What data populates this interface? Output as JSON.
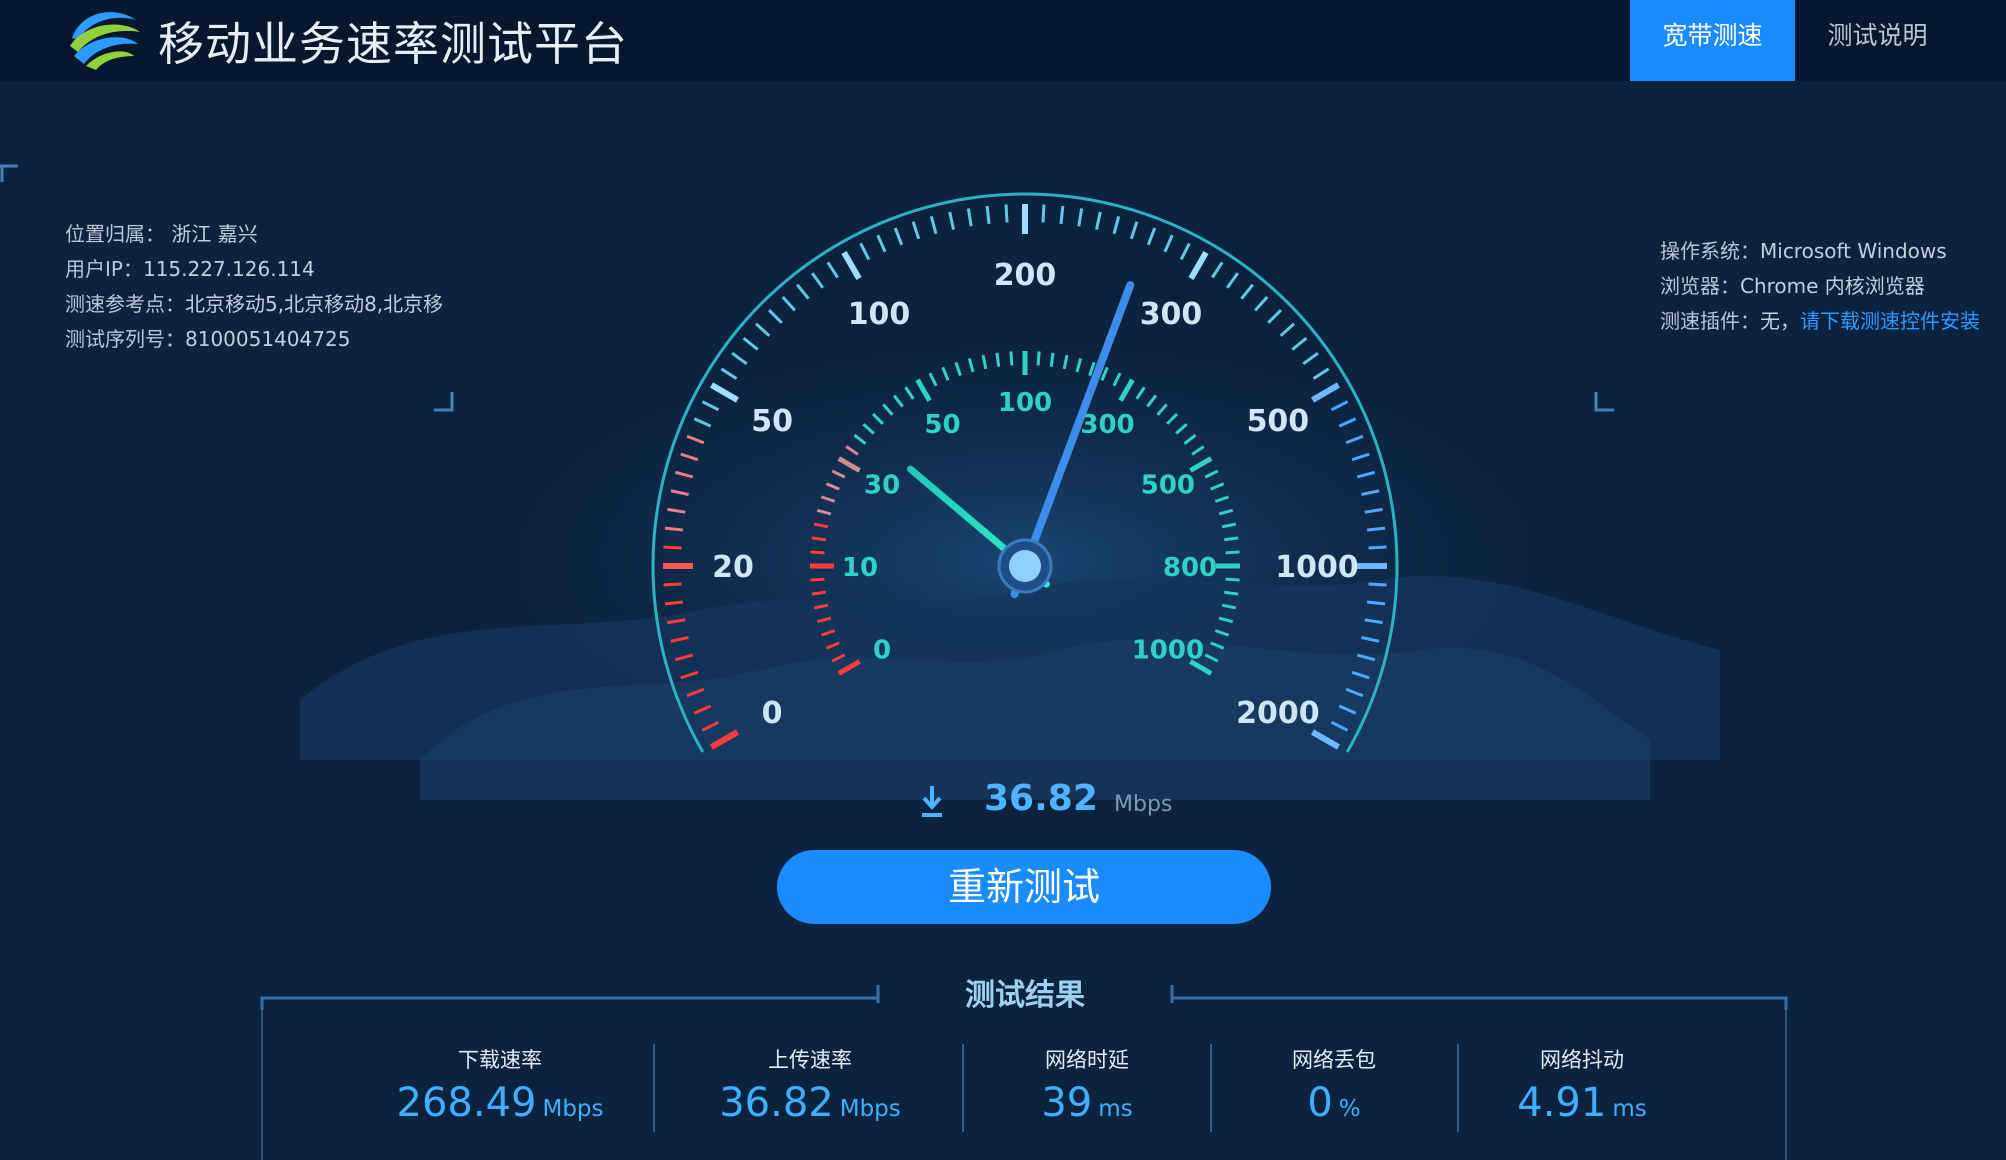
{
  "header": {
    "title": "移动业务速率测试平台",
    "tabs": [
      {
        "label": "宽带测速",
        "active": true
      },
      {
        "label": "测试说明",
        "active": false
      }
    ]
  },
  "info_left": {
    "location_label": "位置归属：",
    "location_value": "浙江 嘉兴",
    "ip_label": "用户IP：",
    "ip_value": "115.227.126.114",
    "ref_label": "测速参考点：",
    "ref_value": "北京移动5,北京移动8,北京移",
    "serial_label": "测试序列号：",
    "serial_value": "8100051404725"
  },
  "info_right": {
    "os_label": "操作系统：",
    "os_value": "Microsoft Windows",
    "browser_label": "浏览器：",
    "browser_value": "Chrome 内核浏览器",
    "plugin_label": "测速插件：",
    "plugin_value": "无，",
    "plugin_link": "请下载测速控件安装"
  },
  "gauge": {
    "outer_labels": [
      "0",
      "20",
      "50",
      "100",
      "200",
      "300",
      "500",
      "1000",
      "2000"
    ],
    "inner_labels": [
      "0",
      "10",
      "30",
      "50",
      "100",
      "300",
      "500",
      "800",
      "1000"
    ],
    "outer_needle_value": 268.49,
    "inner_needle_value": 36.82
  },
  "speed": {
    "value": "36.82",
    "unit": "Mbps",
    "icon": "download-arrow-icon"
  },
  "retest_label": "重新测试",
  "results": {
    "title": "测试结果",
    "items": [
      {
        "label": "下载速率",
        "value": "268.49",
        "unit": "Mbps"
      },
      {
        "label": "上传速率",
        "value": "36.82",
        "unit": "Mbps"
      },
      {
        "label": "网络时延",
        "value": "39",
        "unit": "ms"
      },
      {
        "label": "网络丢包",
        "value": "0",
        "unit": "%"
      },
      {
        "label": "网络抖动",
        "value": "4.91",
        "unit": "ms"
      }
    ]
  },
  "colors": {
    "header_bg": "#06182f",
    "page_bg": "#0c2340",
    "accent": "#1a8cff",
    "value_blue": "#3fb0ff",
    "gauge_teal": "#2ed3c6",
    "gauge_red": "#ff3b3b"
  }
}
